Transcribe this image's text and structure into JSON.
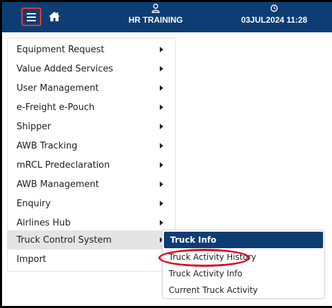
{
  "header": {
    "user_name": "HR TRAINING",
    "datetime": "03JUL2024 11:28",
    "menu_icon": "hamburger-icon",
    "home_icon": "home-icon",
    "user_icon": "user-icon",
    "clock_icon": "clock-icon",
    "bar_color": "#0e3d73"
  },
  "menu": {
    "items": [
      {
        "label": "Equipment Request"
      },
      {
        "label": "Value Added Services"
      },
      {
        "label": "User Management"
      },
      {
        "label": "e-Freight e-Pouch"
      },
      {
        "label": "Shipper"
      },
      {
        "label": "AWB Tracking"
      },
      {
        "label": "mRCL Predeclaration"
      },
      {
        "label": "AWB Management"
      },
      {
        "label": "Enquiry"
      },
      {
        "label": "Airlines Hub"
      },
      {
        "label": "Truck Control System"
      },
      {
        "label": "Import"
      }
    ],
    "active_item": "Truck Control System"
  },
  "submenu": {
    "items": [
      {
        "label": "Truck Info"
      },
      {
        "label": "Truck Activity History"
      },
      {
        "label": "Truck Activity Info"
      },
      {
        "label": "Current Truck Activity"
      }
    ],
    "highlighted_item": "Truck Info",
    "annotated_item": "Truck Activity History",
    "annotation_color": "#e0001b"
  }
}
